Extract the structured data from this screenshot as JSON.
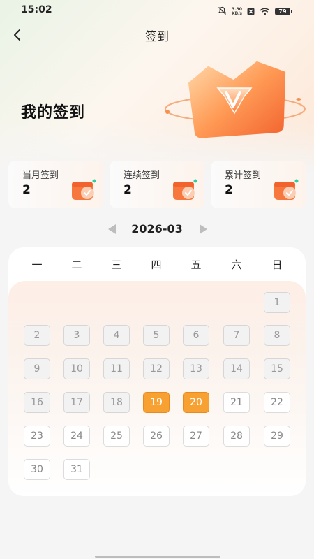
{
  "status_bar": {
    "time": "15:02",
    "net_speed_value": "3.80",
    "net_speed_unit": "KB/s",
    "battery": "79"
  },
  "nav": {
    "title": "签到"
  },
  "hero": {
    "title": "我的签到"
  },
  "stats": [
    {
      "label": "当月签到",
      "value": "2"
    },
    {
      "label": "连续签到",
      "value": "2"
    },
    {
      "label": "累计签到",
      "value": "2"
    }
  ],
  "month": {
    "label": "2026-03"
  },
  "calendar": {
    "weekdays": [
      "一",
      "二",
      "三",
      "四",
      "五",
      "六",
      "日"
    ],
    "days": [
      "1",
      "2",
      "3",
      "4",
      "5",
      "6",
      "7",
      "8",
      "9",
      "10",
      "11",
      "12",
      "13",
      "14",
      "15",
      "16",
      "17",
      "18",
      "19",
      "20",
      "21",
      "22",
      "23",
      "24",
      "25",
      "26",
      "27",
      "28",
      "29",
      "30",
      "31"
    ],
    "first_weekday_index": 6,
    "signed_days": [
      19,
      20
    ],
    "today": 20
  },
  "colors": {
    "accent": "#f6a132",
    "accent_border": "#e98a1e",
    "brand": "#f26a3a"
  }
}
